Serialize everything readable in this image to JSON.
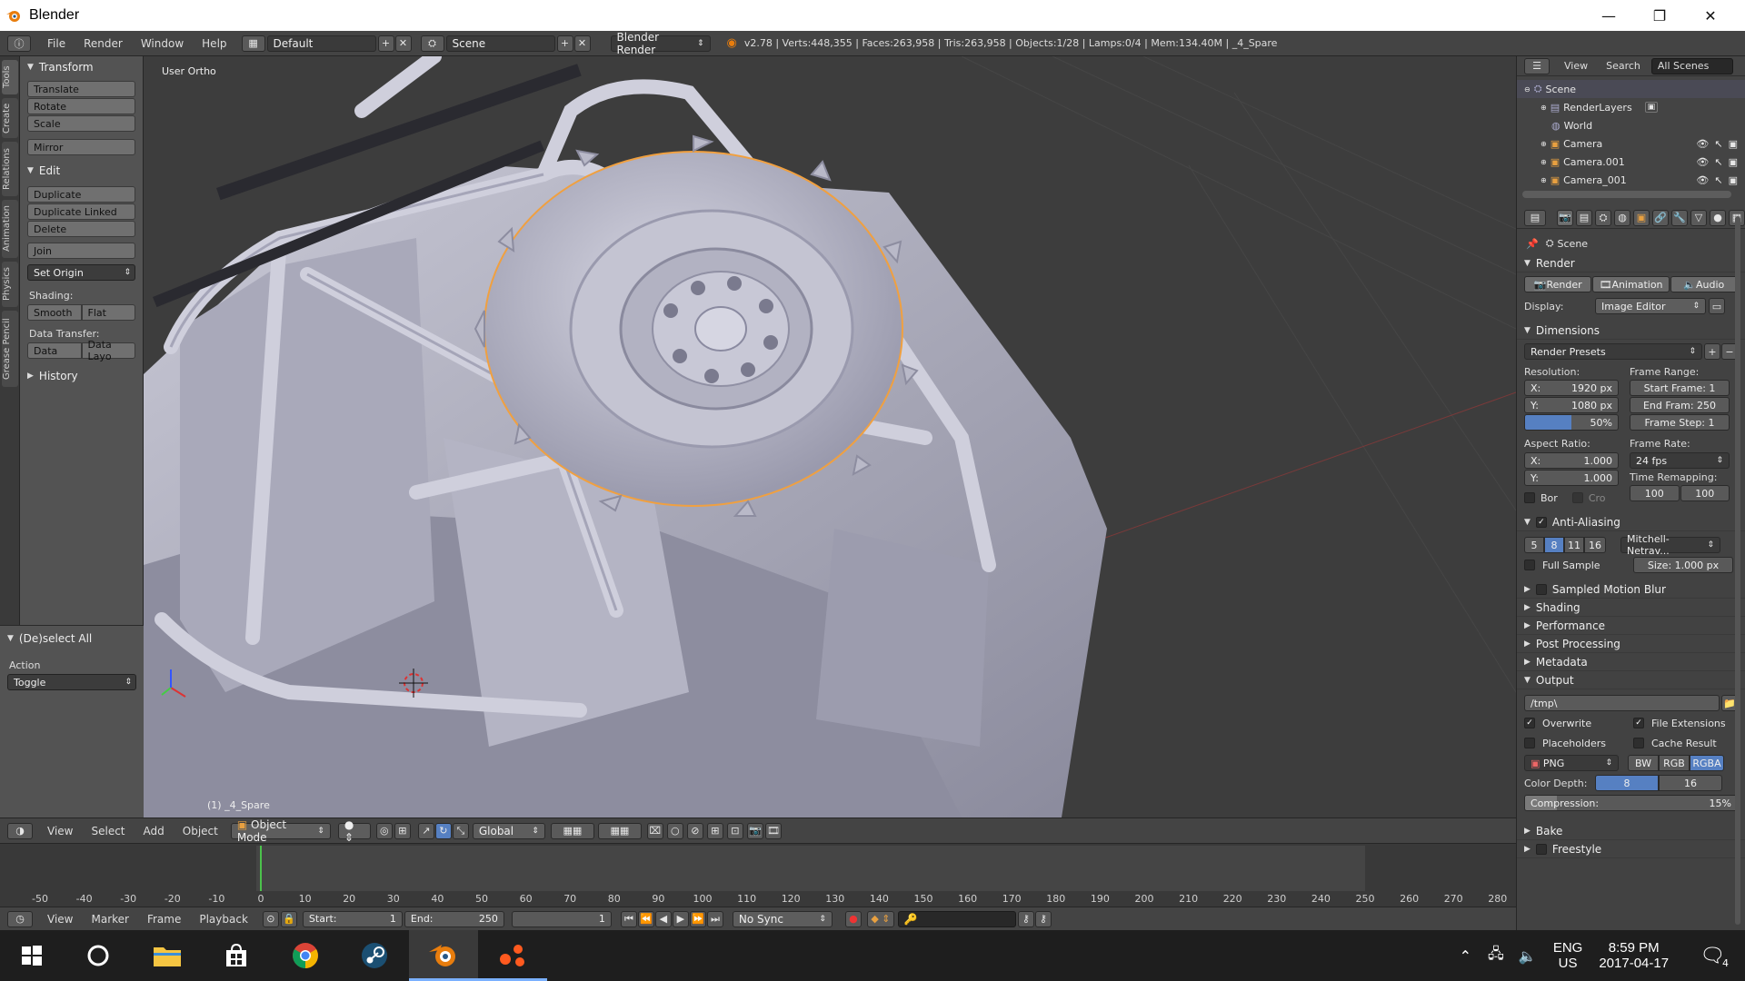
{
  "window": {
    "title": "Blender",
    "controls": [
      "—",
      "❐",
      "✕"
    ]
  },
  "info_header": {
    "menus": [
      "File",
      "Render",
      "Window",
      "Help"
    ],
    "screen_layout": "Default",
    "scene": "Scene",
    "render_engine": "Blender Render",
    "stats": "v2.78 | Verts:448,355 | Faces:263,958 | Tris:263,958 | Objects:1/28 | Lamps:0/4 | Mem:134.40M | _4_Spare"
  },
  "tool_tabs": [
    "Tools",
    "Create",
    "Relations",
    "Animation",
    "Physics",
    "Grease Pencil"
  ],
  "toolshelf": {
    "transform": {
      "title": "Transform",
      "buttons": [
        "Translate",
        "Rotate",
        "Scale",
        "Mirror"
      ]
    },
    "edit": {
      "title": "Edit",
      "buttons": [
        "Duplicate",
        "Duplicate Linked",
        "Delete",
        "Join"
      ],
      "set_origin": "Set Origin",
      "shading_label": "Shading:",
      "smooth": "Smooth",
      "flat": "Flat",
      "data_transfer_label": "Data Transfer:",
      "data": "Data",
      "data_layout": "Data Layo"
    },
    "history": {
      "title": "History"
    },
    "operator": {
      "title": "(De)select All",
      "action_label": "Action",
      "action_value": "Toggle"
    }
  },
  "viewport": {
    "view_label": "User Ortho",
    "object_label": "(1) _4_Spare"
  },
  "view3d_header": {
    "menus": [
      "View",
      "Select",
      "Add",
      "Object"
    ],
    "mode": "Object Mode",
    "orientation": "Global"
  },
  "timeline": {
    "ticks": [
      "-50",
      "-40",
      "-30",
      "-20",
      "-10",
      "0",
      "10",
      "20",
      "30",
      "40",
      "50",
      "60",
      "70",
      "80",
      "90",
      "100",
      "110",
      "120",
      "130",
      "140",
      "150",
      "160",
      "170",
      "180",
      "190",
      "200",
      "210",
      "220",
      "230",
      "240",
      "250",
      "260",
      "270",
      "280"
    ],
    "menus": [
      "View",
      "Marker",
      "Frame",
      "Playback"
    ],
    "start_label": "Start:",
    "start_value": "1",
    "end_label": "End:",
    "end_value": "250",
    "current_frame": "1",
    "sync": "No Sync"
  },
  "outliner": {
    "menus": [
      "View",
      "Search"
    ],
    "filter": "All Scenes",
    "items": [
      "Scene",
      "RenderLayers",
      "World",
      "Camera",
      "Camera.001",
      "Camera_001"
    ]
  },
  "properties": {
    "context": "Scene",
    "render": {
      "title": "Render",
      "render_btn": "Render",
      "animation_btn": "Animation",
      "audio_btn": "Audio",
      "display_label": "Display:",
      "display_value": "Image Editor"
    },
    "dimensions": {
      "title": "Dimensions",
      "presets": "Render Presets",
      "resolution_label": "Resolution:",
      "res_x_label": "X:",
      "res_x": "1920 px",
      "res_y_label": "Y:",
      "res_y": "1080 px",
      "res_pct": "50%",
      "frame_range_label": "Frame Range:",
      "start_frame": "Start Frame: 1",
      "end_frame": "End Fram: 250",
      "frame_step": "Frame Step: 1",
      "aspect_label": "Aspect Ratio:",
      "aspect_x_label": "X:",
      "aspect_x": "1.000",
      "aspect_y_label": "Y:",
      "aspect_y": "1.000",
      "frame_rate_label": "Frame Rate:",
      "frame_rate": "24 fps",
      "time_remap_label": "Time Remapping:",
      "remap_old": "100",
      "remap_new": "100",
      "border": "Bor",
      "crop": "Cro"
    },
    "anti_aliasing": {
      "title": "Anti-Aliasing",
      "samples": [
        "5",
        "8",
        "11",
        "16"
      ],
      "filter": "Mitchell-Netrav...",
      "full_sample": "Full Sample",
      "size": "Size: 1.000 px"
    },
    "collapsed_panels": [
      "Sampled Motion Blur",
      "Shading",
      "Performance",
      "Post Processing",
      "Metadata"
    ],
    "output": {
      "title": "Output",
      "path": "/tmp\\",
      "overwrite": "Overwrite",
      "file_extensions": "File Extensions",
      "placeholders": "Placeholders",
      "cache_result": "Cache Result",
      "format": "PNG",
      "bw": "BW",
      "rgb": "RGB",
      "rgba": "RGBA",
      "color_depth_label": "Color Depth:",
      "depth_8": "8",
      "depth_16": "16",
      "compression": "Compression:",
      "compression_value": "15%"
    },
    "bake": "Bake",
    "freestyle": "Freestyle"
  },
  "taskbar": {
    "lang_top": "ENG",
    "lang_bottom": "US",
    "time": "8:59 PM",
    "date": "2017-04-17",
    "notifications": "4"
  },
  "colors": {
    "accent_blue": "#5680c2",
    "blender_orange": "#e87d0d",
    "selection_outline": "#f0a040"
  }
}
